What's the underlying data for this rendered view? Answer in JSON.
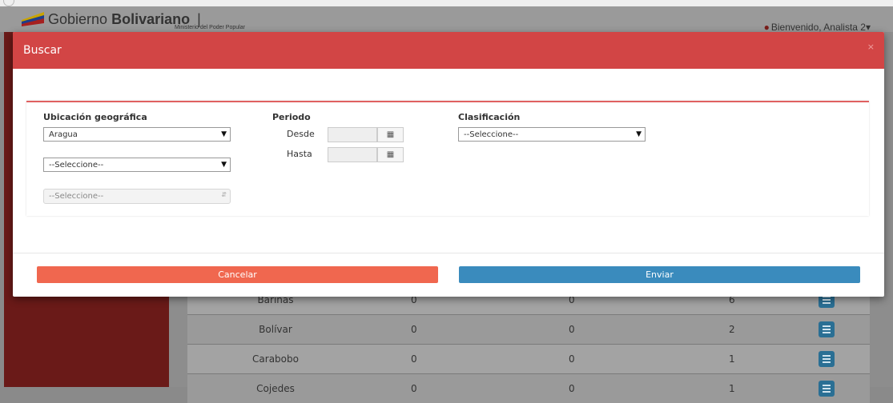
{
  "header": {
    "brand_light": "Gobierno",
    "brand_bold": "Bolivariano",
    "brand_sep": "|",
    "brand_sub": "Ministerio del Poder Popular",
    "user_label": "Bienvenido, Analista 2",
    "user_caret": "▾"
  },
  "table": {
    "rows": [
      {
        "name": "Barinas",
        "a": "0",
        "b": "0",
        "c": "6"
      },
      {
        "name": "Bolívar",
        "a": "0",
        "b": "0",
        "c": "2"
      },
      {
        "name": "Carabobo",
        "a": "0",
        "b": "0",
        "c": "1"
      },
      {
        "name": "Cojedes",
        "a": "0",
        "b": "0",
        "c": "1"
      }
    ]
  },
  "modal": {
    "title": "Buscar",
    "close": "×",
    "ubicacion": {
      "label": "Ubicación geográfica",
      "estado_value": "Aragua",
      "municipio_value": "--Seleccione--",
      "parroquia_value": "--Seleccione--"
    },
    "periodo": {
      "label": "Periodo",
      "desde_label": "Desde",
      "hasta_label": "Hasta",
      "desde_value": "",
      "hasta_value": ""
    },
    "clasificacion": {
      "label": "Clasificación",
      "value": "--Seleccione--"
    },
    "buttons": {
      "cancel": "Cancelar",
      "send": "Enviar"
    }
  },
  "colors": {
    "modal_header": "#d24545",
    "cancel": "#f0674f",
    "send": "#3a8bbd"
  }
}
